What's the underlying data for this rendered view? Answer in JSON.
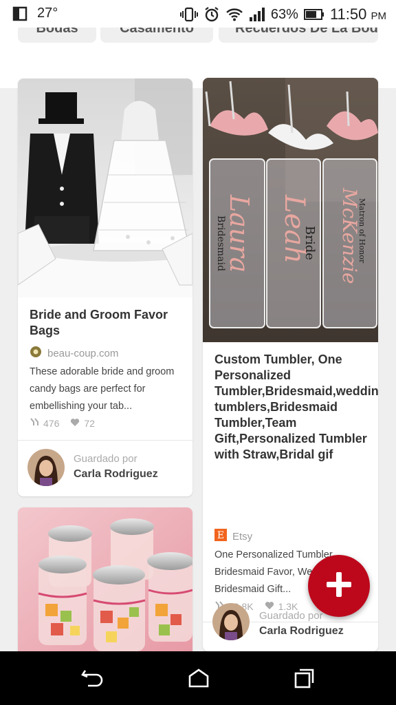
{
  "status_bar": {
    "temperature": "27°",
    "battery": "63%",
    "time": "11:50",
    "time_suffix": "PM"
  },
  "chips": [
    {
      "label": "Bodas"
    },
    {
      "label": "Casamento"
    },
    {
      "label": "Recuerdos De La Boda"
    }
  ],
  "pins": [
    {
      "title": "Bride and Groom Favor Bags",
      "source": "beau-coup.com",
      "description": "These adorable bride and groom candy bags are perfect for embellishing your tab...",
      "saves": "476",
      "likes": "72",
      "saved_by_label": "Guardado por",
      "saver": "Carla Rodriguez"
    },
    {
      "title": "Custom Tumbler, One Personalized Tumbler,Bridesmaid,wedding tumblers,Bridesmaid Tumbler,Team Gift,Personalized Tumbler with Straw,Bridal gif",
      "source": "Etsy",
      "description": "One Personalized Tumbler, Bridesmaid Favor, Wedding Favor, Bridesmaid Gift...",
      "saves": "13.8K",
      "likes": "1.3K",
      "saved_by_label": "Guardado por",
      "saver": "Carla Rodriguez",
      "image_text": {
        "name1": "Laura",
        "role1": "Bridesmaid",
        "name2": "Leah",
        "role2": "Bride",
        "name3": "McKenzie",
        "role3": "Matron of Honor"
      }
    },
    {
      "title": "",
      "image": "jars-of-candy"
    }
  ],
  "colors": {
    "accent_red": "#bd081c",
    "page_bg": "#efefef",
    "etsy_orange": "#f1641e"
  }
}
